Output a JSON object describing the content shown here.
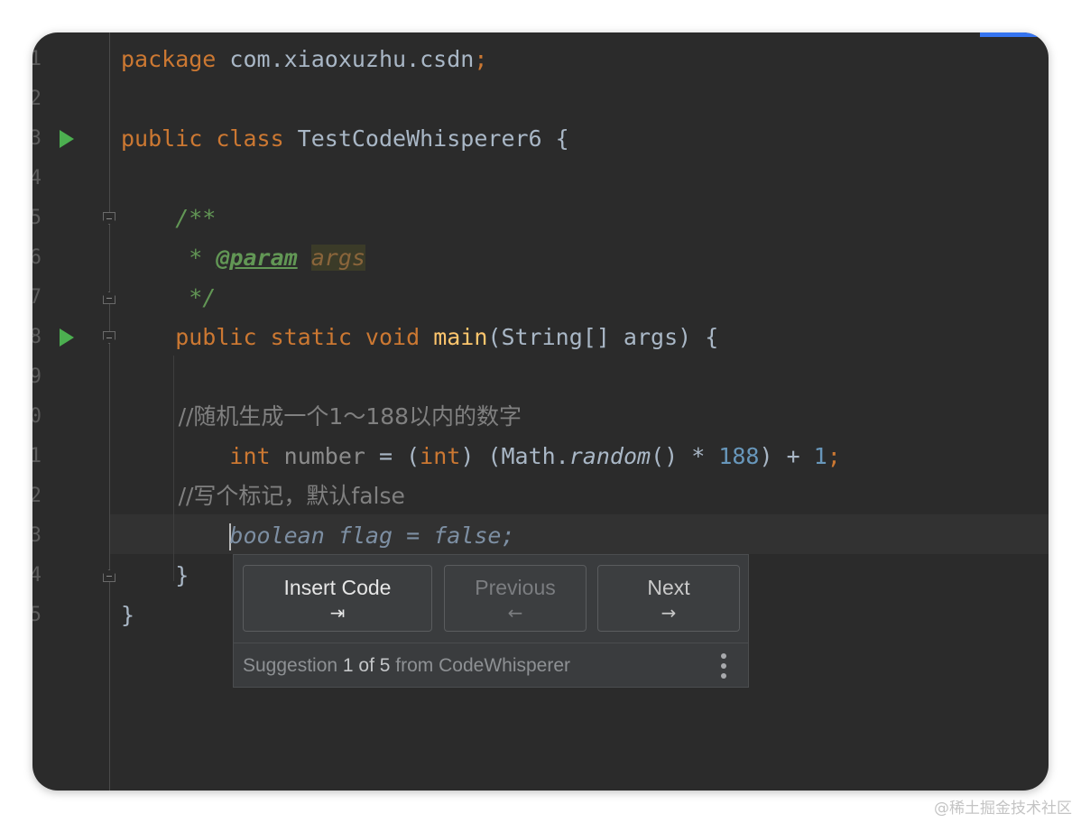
{
  "editor": {
    "line_numbers": [
      "1",
      "2",
      "3",
      "4",
      "5",
      "6",
      "7",
      "8",
      "9",
      "0",
      "1",
      "2",
      "3",
      "4",
      "5"
    ],
    "lines": [
      {
        "segments": [
          {
            "t": "package",
            "c": "kw"
          },
          {
            "t": " com.xiaoxuzhu.csdn",
            "c": ""
          },
          {
            "t": ";",
            "c": "kw"
          }
        ]
      },
      {
        "segments": []
      },
      {
        "segments": [
          {
            "t": "public class ",
            "c": "kw"
          },
          {
            "t": "TestCodeWhisperer6 {",
            "c": ""
          }
        ]
      },
      {
        "segments": []
      },
      {
        "segments": [
          {
            "t": "    /**",
            "c": "doc"
          }
        ]
      },
      {
        "segments": [
          {
            "t": "     * ",
            "c": "doc"
          },
          {
            "t": "@param",
            "c": "doctag"
          },
          {
            "t": " ",
            "c": "doc"
          },
          {
            "t": "args",
            "c": "docparam"
          }
        ]
      },
      {
        "segments": [
          {
            "t": "     */",
            "c": "doc"
          }
        ]
      },
      {
        "segments": [
          {
            "t": "    public static void ",
            "c": "kw"
          },
          {
            "t": "main",
            "c": "fn"
          },
          {
            "t": "(String[] args) {",
            "c": ""
          }
        ]
      },
      {
        "segments": []
      },
      {
        "segments": [
          {
            "t": "        //随机生成一个1～188以内的数字",
            "c": "com"
          }
        ]
      },
      {
        "segments": [
          {
            "t": "        ",
            "c": ""
          },
          {
            "t": "int",
            "c": "kw"
          },
          {
            "t": " ",
            "c": ""
          },
          {
            "t": "number",
            "c": "gray"
          },
          {
            "t": " = (",
            "c": ""
          },
          {
            "t": "int",
            "c": "kw"
          },
          {
            "t": ") (Math.",
            "c": ""
          },
          {
            "t": "random",
            "c": "ital"
          },
          {
            "t": "() * ",
            "c": ""
          },
          {
            "t": "188",
            "c": "num"
          },
          {
            "t": ") + ",
            "c": ""
          },
          {
            "t": "1",
            "c": "num"
          },
          {
            "t": ";",
            "c": "kw"
          }
        ]
      },
      {
        "segments": [
          {
            "t": "        //写个标记，默认false",
            "c": "com"
          }
        ]
      },
      {
        "segments": [
          {
            "t": "        ",
            "c": ""
          },
          {
            "t": "|",
            "c": "caret"
          },
          {
            "t": "boolean flag = false;",
            "c": "ghost"
          }
        ]
      },
      {
        "segments": [
          {
            "t": "    }",
            "c": ""
          }
        ]
      },
      {
        "segments": [
          {
            "t": "}",
            "c": ""
          }
        ]
      }
    ],
    "run_gutter_lines": [
      3,
      8
    ],
    "fold_start_lines": [
      5,
      8
    ],
    "fold_end_lines": [
      7,
      14
    ]
  },
  "suggestion_popup": {
    "insert_label": "Insert Code",
    "insert_glyph": "⇥",
    "previous_label": "Previous",
    "previous_glyph": "←",
    "next_label": "Next",
    "next_glyph": "→",
    "footer_prefix": "Suggestion ",
    "footer_index": "1 of 5",
    "footer_suffix": " from CodeWhisperer",
    "more_icon": "vertical-ellipsis-icon"
  },
  "watermark": "@稀土掘金技术社区",
  "colors": {
    "editor_bg": "#2b2b2b",
    "keyword": "#cc7832",
    "function": "#ffc66d",
    "number": "#6897bb",
    "doc_comment": "#629755",
    "run_icon": "#4caf50",
    "accent": "#3574f0"
  }
}
